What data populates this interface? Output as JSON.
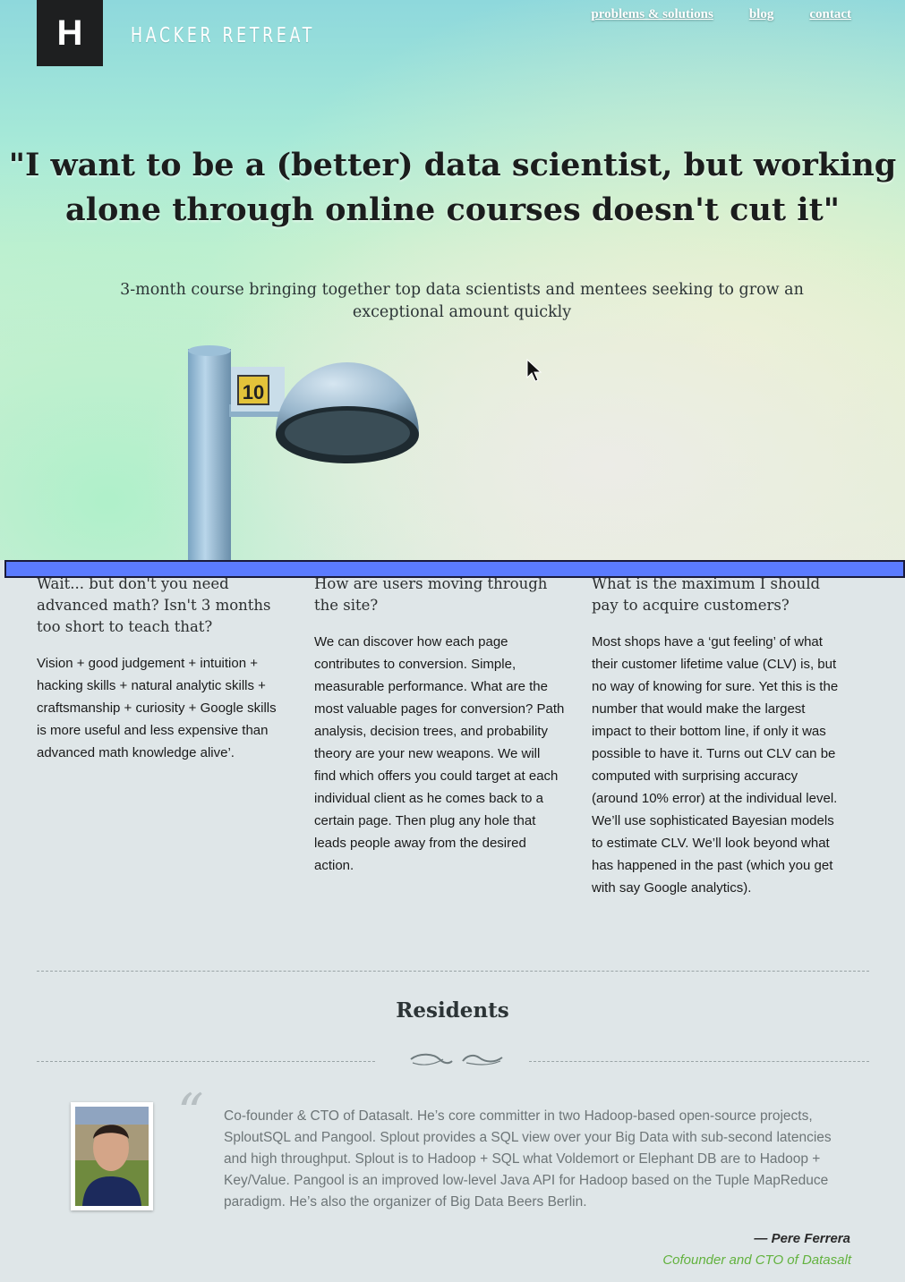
{
  "brand": {
    "logo_letter": "H",
    "name": "HACKER RETREAT"
  },
  "nav": {
    "items": [
      {
        "label": "problems & solutions"
      },
      {
        "label": "blog"
      },
      {
        "label": "contact"
      }
    ]
  },
  "hero": {
    "headline_line1": "\"I want to be a (better) data scientist, but working",
    "headline_line2": "alone through online courses doesn't cut it\"",
    "subhead": "3-month course bringing together top data scientists and mentees seeking to grow an exceptional amount quickly",
    "lamp_number": "10"
  },
  "features": [
    {
      "title": "Wait... but don't you need advanced math? Isn't 3 months too short to teach that?",
      "body": "Vision + good judgement + intuition + hacking skills + natural analytic skills + craftsmanship + curiosity + Google skills is more useful and less expensive than advanced math knowledge alive’."
    },
    {
      "title": "How are users moving through the site?",
      "body": "We can discover how each page contributes to conversion. Simple, measurable performance. What are the most valuable pages for conversion? Path analysis, decision trees, and probability theory are your new weapons. We will find which offers you could target at each individual client as he comes back to a certain page. Then plug any hole that leads people away from the desired action."
    },
    {
      "title": "What is the maximum I should pay to acquire customers?",
      "body": "Most shops have a ‘gut feeling’ of what their customer lifetime value (CLV) is, but no way of knowing for sure. Yet this is the number that would make the largest impact to their bottom line, if only it was possible to have it. Turns out CLV can be computed with surprising accuracy (around 10% error) at the individual level. We’ll use sophisticated Bayesian models to estimate CLV. We’ll look beyond what has happened in the past (which you get with say Google analytics)."
    }
  ],
  "residents": {
    "title": "Residents",
    "quote_mark": "“",
    "bio": "Co-founder & CTO of Datasalt. He’s core committer in two Hadoop-based open-source projects, SploutSQL and Pangool. Splout provides a SQL view over your Big Data with sub-second latencies and high throughput. Splout is to Hadoop + SQL what Voldemort or Elephant DB are to Hadoop + Key/Value. Pangool is an improved low-level Java API for Hadoop based on the Tuple MapReduce paradigm. He’s also the organizer of Big Data Beers Berlin.",
    "name": "— Pere Ferrera",
    "role": "Cofounder and CTO of Datasalt"
  },
  "colors": {
    "accent_blue_bar": "#5b7bff",
    "role_green": "#62b23e",
    "logo_bg": "#1e1f20"
  }
}
